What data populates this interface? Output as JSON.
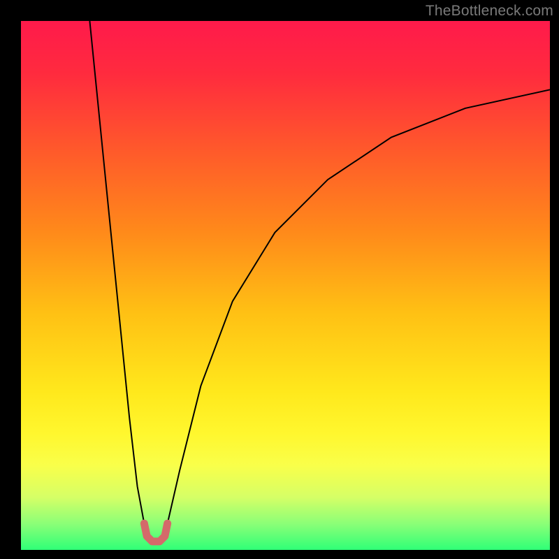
{
  "watermark": "TheBottleneck.com",
  "chart_data": {
    "type": "line",
    "title": "",
    "xlabel": "",
    "ylabel": "",
    "xlim": [
      0,
      100
    ],
    "ylim": [
      0,
      100
    ],
    "grid": false,
    "legend": false,
    "background_gradient": {
      "stops": [
        {
          "offset": 0.0,
          "color": "#ff1a4b"
        },
        {
          "offset": 0.1,
          "color": "#ff2b3e"
        },
        {
          "offset": 0.25,
          "color": "#ff5b2a"
        },
        {
          "offset": 0.4,
          "color": "#ff8a1a"
        },
        {
          "offset": 0.55,
          "color": "#ffc014"
        },
        {
          "offset": 0.7,
          "color": "#ffe81c"
        },
        {
          "offset": 0.78,
          "color": "#fff72e"
        },
        {
          "offset": 0.84,
          "color": "#f9ff4a"
        },
        {
          "offset": 0.9,
          "color": "#d6ff66"
        },
        {
          "offset": 0.95,
          "color": "#8cff77"
        },
        {
          "offset": 1.0,
          "color": "#2fff77"
        }
      ]
    },
    "series": [
      {
        "name": "curve-left",
        "stroke": "#000000",
        "stroke_width": 2,
        "x": [
          13.0,
          14.5,
          16.0,
          17.5,
          19.0,
          20.5,
          22.0,
          23.3
        ],
        "y": [
          100.0,
          85.0,
          70.0,
          55.0,
          40.0,
          25.0,
          12.0,
          5.0
        ]
      },
      {
        "name": "curve-right",
        "stroke": "#000000",
        "stroke_width": 2,
        "x": [
          27.7,
          30.0,
          34.0,
          40.0,
          48.0,
          58.0,
          70.0,
          84.0,
          100.0
        ],
        "y": [
          5.0,
          15.0,
          31.0,
          47.0,
          60.0,
          70.0,
          78.0,
          83.5,
          87.0
        ]
      },
      {
        "name": "valley-highlight",
        "stroke": "#d46a6a",
        "stroke_width": 11,
        "linecap": "round",
        "x": [
          23.3,
          23.8,
          24.8,
          26.2,
          27.2,
          27.7
        ],
        "y": [
          5.0,
          2.6,
          1.6,
          1.6,
          2.6,
          5.0
        ]
      }
    ]
  }
}
